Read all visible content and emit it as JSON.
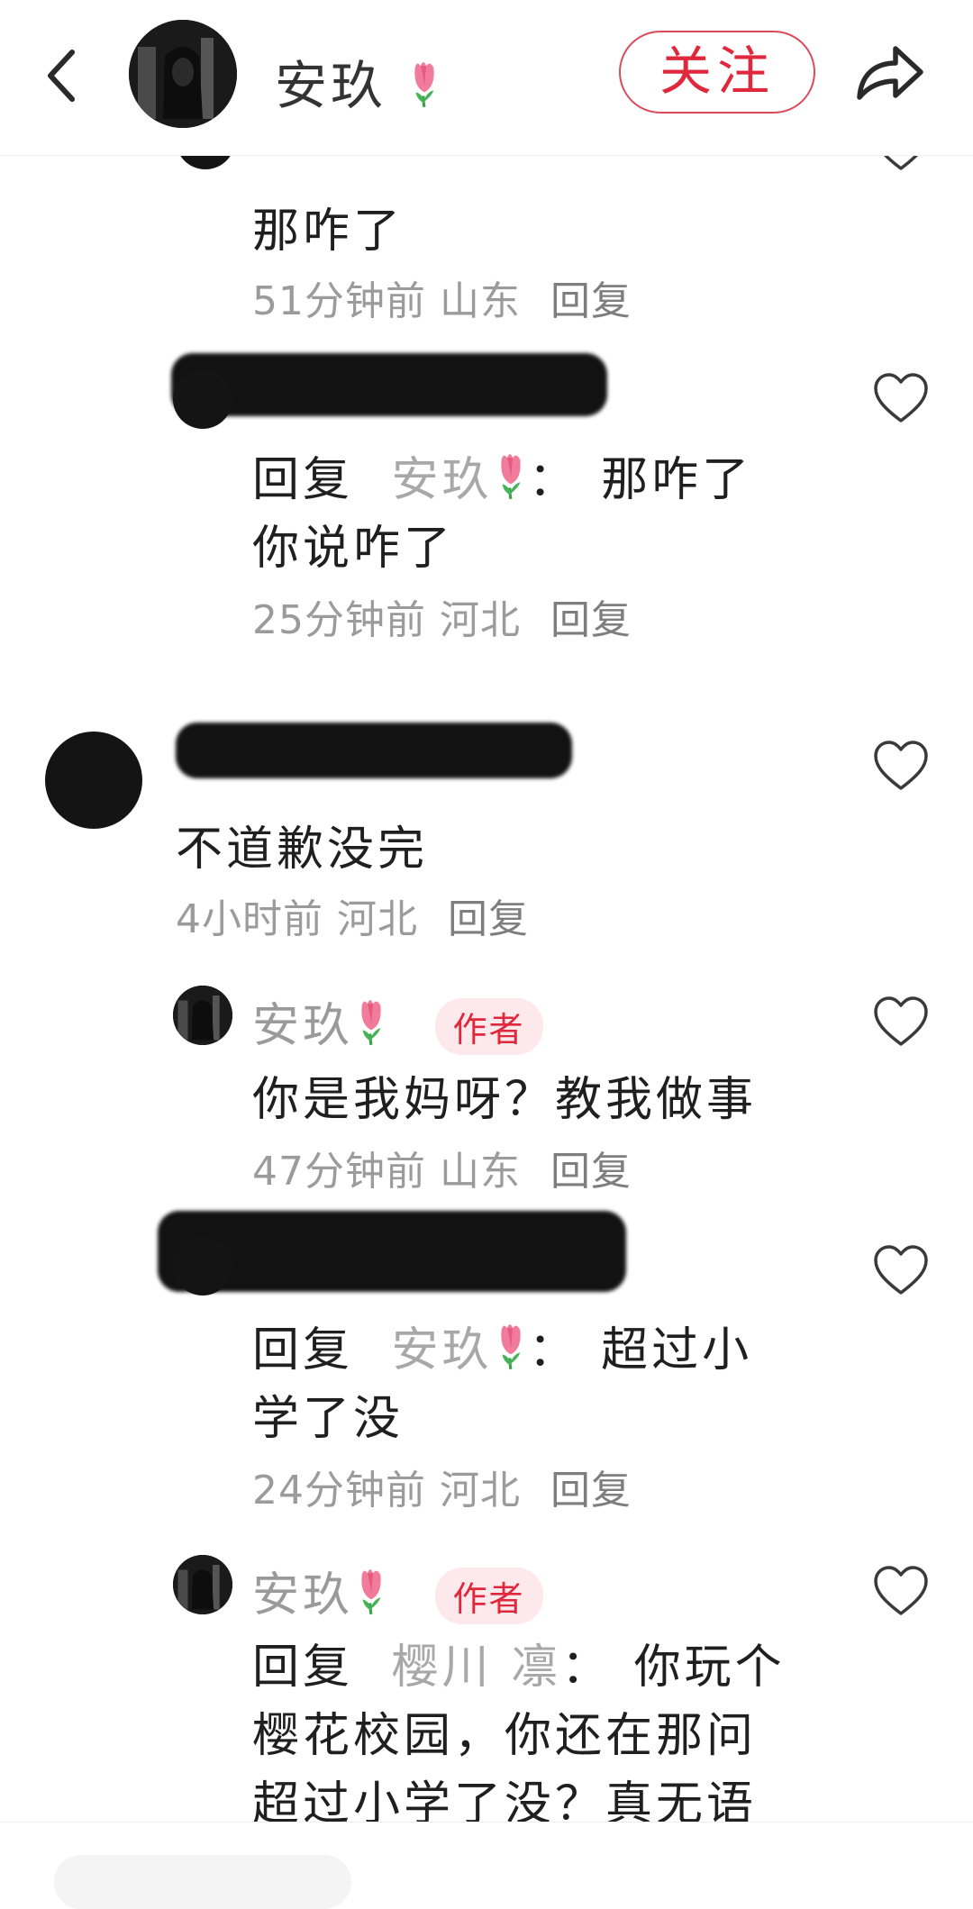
{
  "header": {
    "user_name": "安玖",
    "follow_label": "关注"
  },
  "comments": [
    {
      "id": "c0",
      "text": "那咋了",
      "time": "51分钟前",
      "location": "山东",
      "reply_label": "回复"
    },
    {
      "id": "c1",
      "reply_prefix": "回复",
      "reply_target": "安玖",
      "colon": "：",
      "line1": "那咋了",
      "line2": "你说咋了",
      "time": "25分钟前",
      "location": "河北",
      "reply_label": "回复"
    },
    {
      "id": "c2",
      "text": "不道歉没完",
      "time": "4小时前",
      "location": "河北",
      "reply_label": "回复"
    },
    {
      "id": "c3",
      "name": "安玖",
      "badge": "作者",
      "text": "你是我妈呀？教我做事",
      "time": "47分钟前",
      "location": "山东",
      "reply_label": "回复"
    },
    {
      "id": "c4",
      "reply_prefix": "回复",
      "reply_target": "安玖",
      "colon": "：",
      "line1": "超过小",
      "line2": "学了没",
      "time": "24分钟前",
      "location": "河北",
      "reply_label": "回复"
    },
    {
      "id": "c5",
      "name": "安玖",
      "badge": "作者",
      "reply_prefix": "回复",
      "reply_target": "樱川 凛",
      "colon": "：",
      "line1": "你玩个",
      "line2": "樱花校园，你还在那问",
      "line3": "超过小学了没？真无语"
    }
  ],
  "icons": {
    "back": "chevron-left-icon",
    "share": "share-arrow-icon",
    "like": "heart-outline-icon",
    "emoji": "tulip-emoji"
  },
  "colors": {
    "accent": "#e0283d",
    "badge_bg": "#fde9ec",
    "meta_gray": "#9b9b9b"
  }
}
